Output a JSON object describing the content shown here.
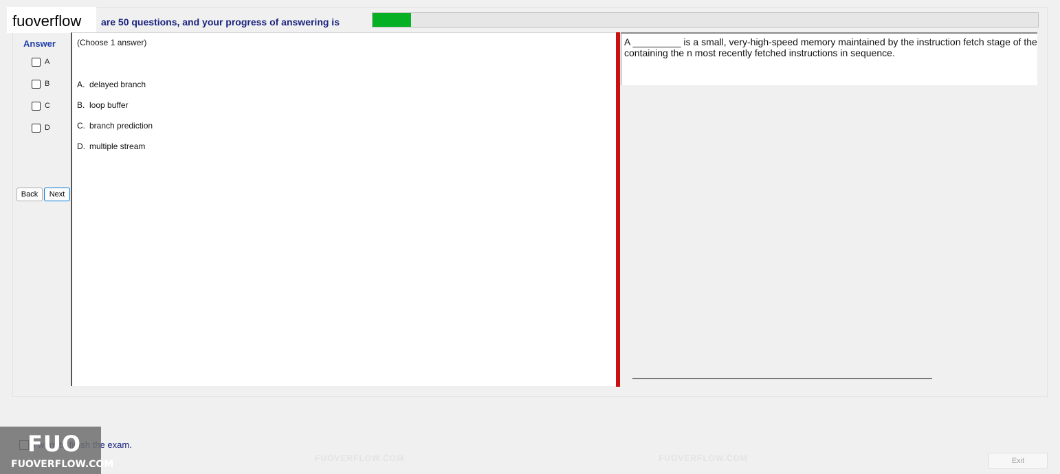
{
  "brand": {
    "name": "fuoverflow"
  },
  "progress": {
    "text": "are 50 questions, and your progress of answering is",
    "fraction": 0.058,
    "fill_color": "#06b025"
  },
  "answer_panel": {
    "title": "Answer",
    "options": [
      "A",
      "B",
      "C",
      "D"
    ]
  },
  "nav": {
    "back_label": "Back",
    "next_label": "Next"
  },
  "question": {
    "instruction": "(Choose 1 answer)",
    "choices": [
      {
        "letter": "A.",
        "text": "delayed branch"
      },
      {
        "letter": "B.",
        "text": "loop buffer"
      },
      {
        "letter": "C.",
        "text": "branch prediction"
      },
      {
        "letter": "D.",
        "text": "multiple stream"
      }
    ],
    "stem_line1": "A _________ is a small, very-high-speed memory maintained by the instruction fetch stage of the pipeline and",
    "stem_line2": "containing the n most recently fetched instructions in sequence."
  },
  "footer": {
    "finish_label": "I want to finish the exam.",
    "exit_label": "Exit"
  },
  "watermark": {
    "logo": "FUO",
    "caption": "FUOVERFLOW.COM",
    "site": "FUOVERFLOW.COM"
  },
  "colors": {
    "divider": "#c91010",
    "accent": "#1a237e"
  }
}
